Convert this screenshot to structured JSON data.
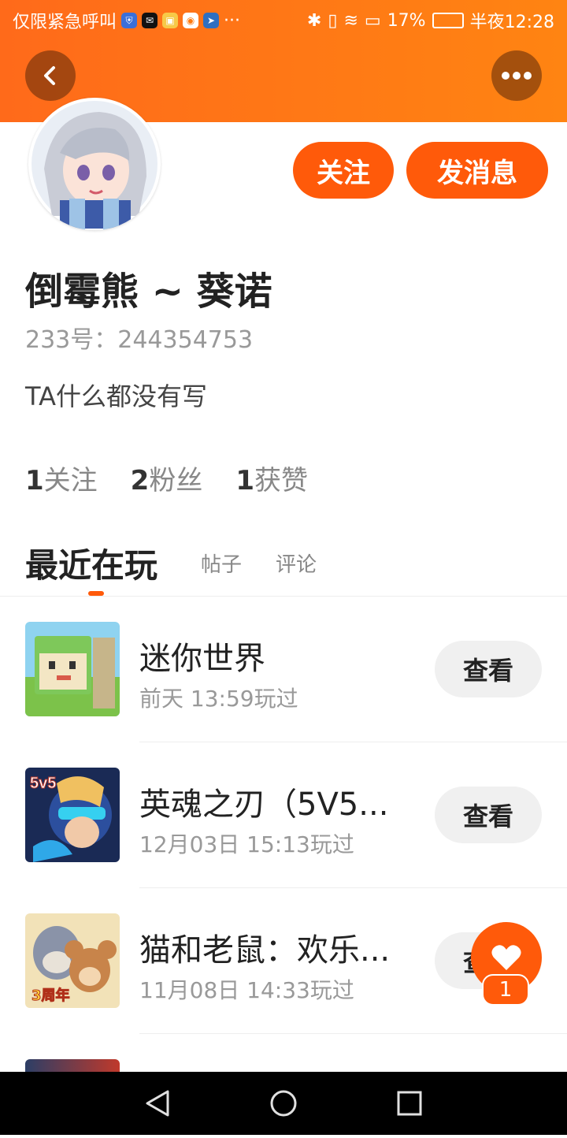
{
  "status_bar": {
    "carrier_text": "仅限紧急呼叫",
    "ellipsis": "···",
    "battery_percent": "17%",
    "time": "半夜12:28"
  },
  "profile": {
    "name": "倒霉熊 ~ 葵诺",
    "id_line": "233号：244354753",
    "bio": "TA什么都没有写",
    "follow_button": "关注",
    "message_button": "发消息"
  },
  "stats": [
    {
      "count": "1",
      "label": "关注"
    },
    {
      "count": "2",
      "label": "粉丝"
    },
    {
      "count": "1",
      "label": "获赞"
    }
  ],
  "tabs": [
    {
      "label": "最近在玩"
    },
    {
      "label": "帖子"
    },
    {
      "label": "评论"
    }
  ],
  "games": [
    {
      "title": "迷你世界",
      "played": "前天 13:59玩过",
      "action": "查看"
    },
    {
      "title": "英魂之刃（5V5...",
      "played": "12月03日 15:13玩过",
      "action": "查看"
    },
    {
      "title": "猫和老鼠：欢乐...",
      "played": "11月08日 14:33玩过",
      "action": "查看"
    }
  ],
  "game_icon_labels": {
    "g1": "",
    "g2": "5v5",
    "g3": "3周年"
  },
  "like": {
    "count": "1"
  },
  "colors": {
    "accent": "#ff5a0a",
    "header_start": "#ff6a1a",
    "header_end": "#ff8412"
  }
}
